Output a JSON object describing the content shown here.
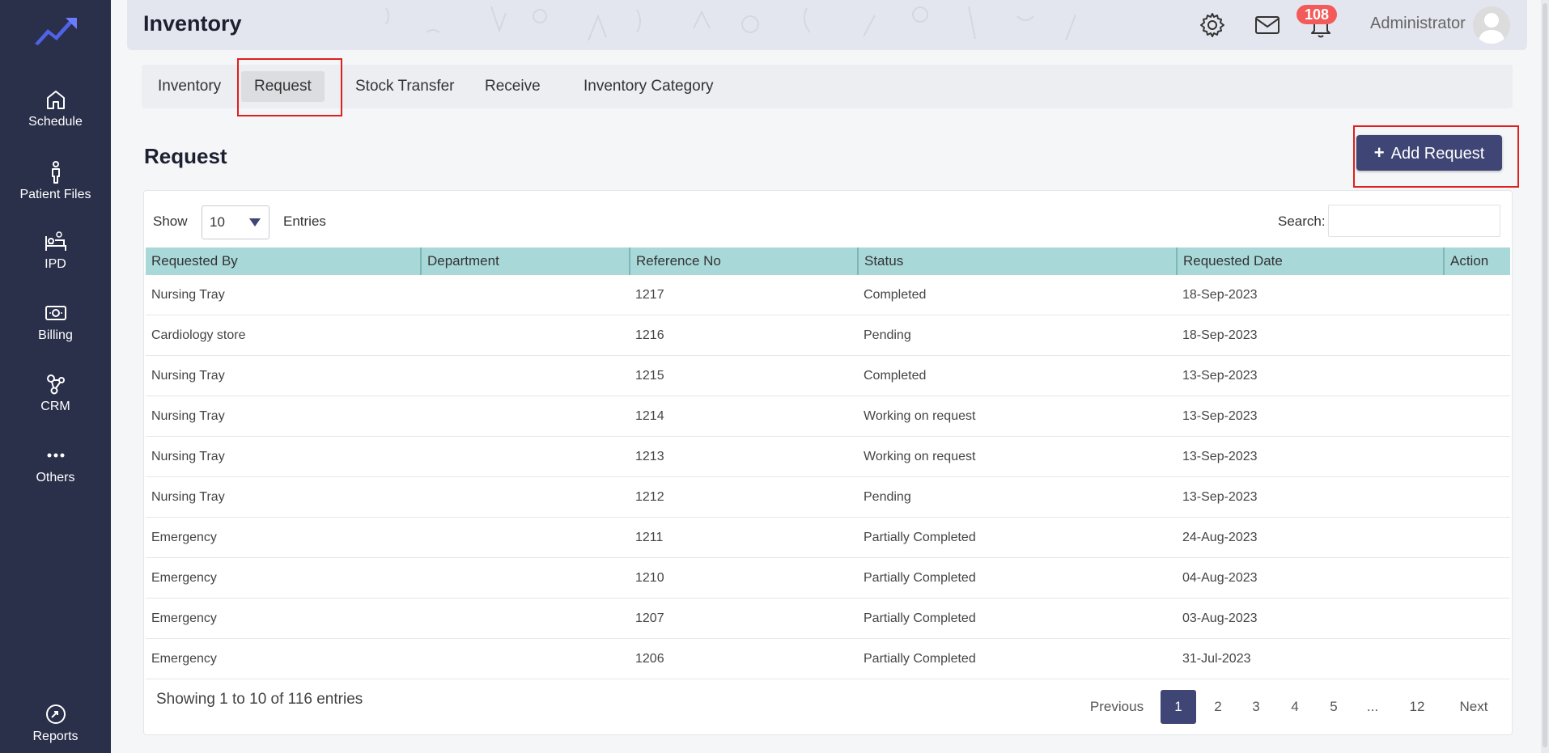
{
  "sidebar": {
    "items": [
      {
        "label": "Schedule",
        "icon": "home-icon"
      },
      {
        "label": "Patient Files",
        "icon": "person-icon"
      },
      {
        "label": "IPD",
        "icon": "bed-icon"
      },
      {
        "label": "Billing",
        "icon": "money-icon"
      },
      {
        "label": "CRM",
        "icon": "network-icon"
      },
      {
        "label": "Others",
        "icon": "more-icon"
      }
    ],
    "reports_label": "Reports"
  },
  "header": {
    "title": "Inventory",
    "notification_count": "108",
    "username": "Administrator"
  },
  "tabs": [
    "Inventory",
    "Request",
    "Stock Transfer",
    "Receive",
    "Inventory Category"
  ],
  "active_tab": "Request",
  "section": {
    "title": "Request",
    "add_button_label": "Add Request"
  },
  "controls": {
    "show_label": "Show",
    "page_size": "10",
    "entries_label": "Entries",
    "search_label": "Search:",
    "search_value": ""
  },
  "table": {
    "columns": [
      "Requested By",
      "Department",
      "Reference No",
      "Status",
      "Requested Date",
      "Action"
    ],
    "rows": [
      [
        "Nursing Tray",
        "",
        "1217",
        "Completed",
        "18-Sep-2023",
        ""
      ],
      [
        "Cardiology store",
        "",
        "1216",
        "Pending",
        "18-Sep-2023",
        ""
      ],
      [
        "Nursing Tray",
        "",
        "1215",
        "Completed",
        "13-Sep-2023",
        ""
      ],
      [
        "Nursing Tray",
        "",
        "1214",
        "Working on request",
        "13-Sep-2023",
        ""
      ],
      [
        "Nursing Tray",
        "",
        "1213",
        "Working on request",
        "13-Sep-2023",
        ""
      ],
      [
        "Nursing Tray",
        "",
        "1212",
        "Pending",
        "13-Sep-2023",
        ""
      ],
      [
        "Emergency",
        "",
        "1211",
        "Partially Completed",
        "24-Aug-2023",
        ""
      ],
      [
        "Emergency",
        "",
        "1210",
        "Partially Completed",
        "04-Aug-2023",
        ""
      ],
      [
        "Emergency",
        "",
        "1207",
        "Partially Completed",
        "03-Aug-2023",
        ""
      ],
      [
        "Emergency",
        "",
        "1206",
        "Partially Completed",
        "31-Jul-2023",
        ""
      ]
    ]
  },
  "footer": {
    "info": "Showing 1 to 10 of 116 entries",
    "pagination": [
      "Previous",
      "1",
      "2",
      "3",
      "4",
      "5",
      "...",
      "12",
      "Next"
    ],
    "current_page": "1"
  },
  "colors": {
    "sidebar_bg": "#2a2f4a",
    "accent": "#3f4575",
    "table_header": "#a9d8d9",
    "badge": "#f35b5b",
    "highlight_box": "#e01f1f"
  }
}
